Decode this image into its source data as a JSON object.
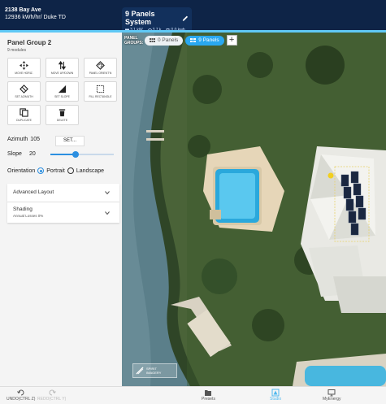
{
  "header": {
    "address": "2138 Bay Ave",
    "usage": "12936 kWh/hr/ Duke TD",
    "system_title": "9 Panels System",
    "stats": [
      "3.1 kW",
      "3.7 k",
      "0.0 kwh"
    ]
  },
  "left_panel": {
    "title": "Panel Group 2",
    "subtitle": "9 modules",
    "tools": [
      {
        "label": "MOVE HORIZ.",
        "icon": "move-arrows-icon"
      },
      {
        "label": "MOVE UP/DOWN",
        "icon": "up-down-arrows-icon"
      },
      {
        "label": "PANEL ORIENT'N",
        "icon": "rotate-panel-icon"
      },
      {
        "label": "SET AZIMUTH",
        "icon": "azimuth-icon"
      },
      {
        "label": "SET SLOPE",
        "icon": "slope-triangle-icon"
      },
      {
        "label": "FILL RECTANGLE",
        "icon": "fill-rectangle-icon"
      },
      {
        "label": "DUPLICATE",
        "icon": "duplicate-icon"
      },
      {
        "label": "DELETE",
        "icon": "trash-icon"
      }
    ],
    "azimuth_label": "Azimuth",
    "azimuth_value": "105",
    "set_button": "SET...",
    "slope_label": "Slope",
    "slope_value": "20",
    "slope_fraction": 0.4,
    "orientation_label": "Orientation",
    "orientation_options": [
      "Portrait",
      "Landscape"
    ],
    "orientation_selected": "Portrait",
    "advanced_layout": "Advanced Layout",
    "shading_title": "Shading",
    "shading_sub": "Annual Losses 0%"
  },
  "map": {
    "groups_label": "PANEL GROUPS:",
    "groups": [
      {
        "label": "0 Panels",
        "active": false
      },
      {
        "label": "9 Panels",
        "active": true
      }
    ],
    "imagery_label": [
      "SPIRIT",
      "IMAGERY"
    ]
  },
  "bottom_bar": {
    "undo": "UNDO(CTRL Z)",
    "redo": "REDO(CTRL Y)",
    "presets": "Presets",
    "studio": "Studio",
    "myenergy": "MyEnergy"
  },
  "colors": {
    "header_bg": "#0e2447",
    "accent": "#2c8fe0",
    "active_pill": "#2aa8f0",
    "active_tab_text": "#4fb8ee"
  }
}
